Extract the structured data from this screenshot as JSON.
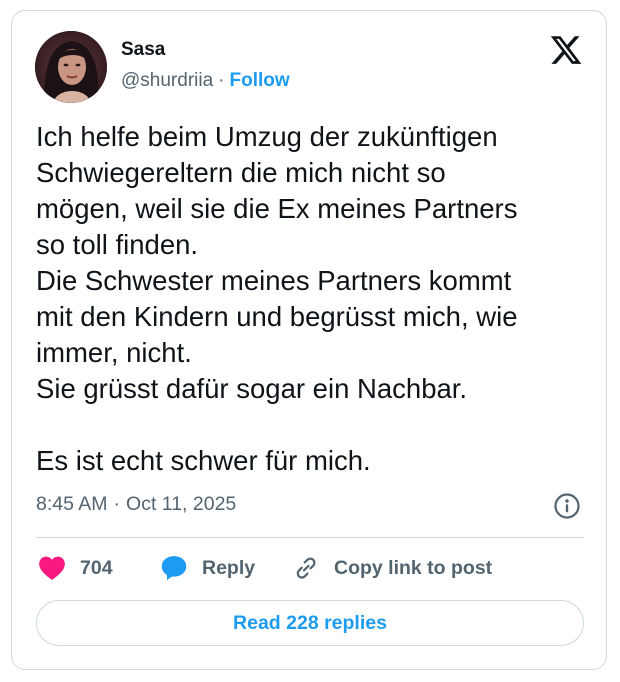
{
  "author": {
    "name": "Sasa",
    "handle": "@shurdriia",
    "separator": "·",
    "follow_label": "Follow"
  },
  "icons": {
    "logo": "x-logo-icon",
    "info": "info-icon",
    "like": "heart-icon",
    "reply": "speech-bubble-icon",
    "copy": "link-icon"
  },
  "tweet": {
    "paragraphs": [
      [
        "Ich helfe beim Umzug der zukünftigen",
        "Schwiegereltern die mich nicht so",
        "mögen, weil sie die Ex meines Partners",
        "so toll finden."
      ],
      [
        "Die Schwester meines Partners kommt",
        "mit den Kindern und begrüsst mich, wie",
        "immer, nicht."
      ],
      [
        "Sie grüsst dafür sogar ein Nachbar."
      ],
      [
        "Es ist echt schwer für mich."
      ]
    ]
  },
  "meta": {
    "time": "8:45 AM",
    "separator": "·",
    "date": "Oct 11, 2025"
  },
  "actions": {
    "like_count": "704",
    "reply_label": "Reply",
    "copy_label": "Copy link to post"
  },
  "read_replies_label": "Read 228 replies",
  "colors": {
    "accent": "#1d9bf0",
    "like": "#f91880",
    "text": "#0f1419",
    "muted": "#536471",
    "border": "#cfd9de"
  }
}
